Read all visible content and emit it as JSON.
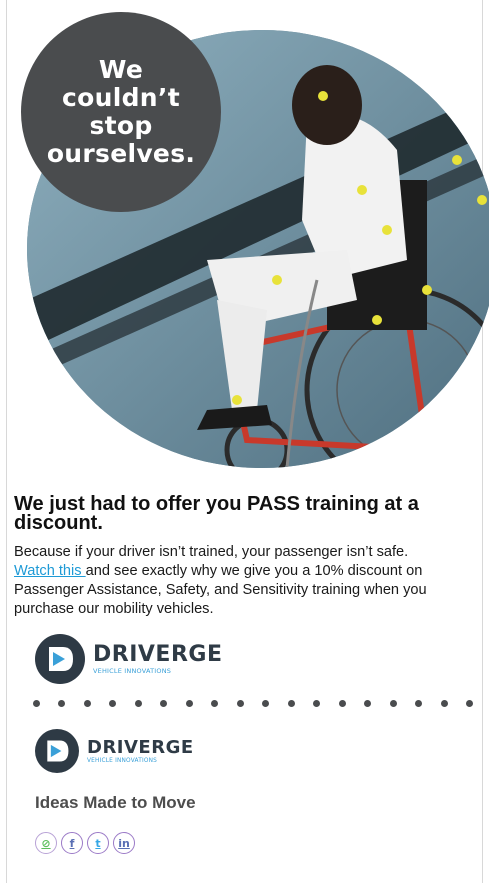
{
  "hero": {
    "bubble_text": "We couldn’t stop ourselves.",
    "image_description_icon": "wheelchair-crash-dummy-image"
  },
  "headline": "We just had to offer you PASS training at a discount.",
  "body": {
    "intro": "Because if your driver isn’t trained, your passenger isn’t safe.",
    "link_text": "Watch this ",
    "rest": "and see exactly why we give you a 10% discount on Passenger Assistance, Safety, and Sensitivity training when you purchase our mobility vehicles."
  },
  "logo": {
    "word": "DRIVERGE",
    "sub": "VEHICLE INNOVATIONS"
  },
  "footer": {
    "tagline": "Ideas Made to Move",
    "social": [
      {
        "icon": "link-icon",
        "glyph": "⊘"
      },
      {
        "icon": "facebook-icon",
        "glyph": "f"
      },
      {
        "icon": "twitter-icon",
        "glyph": "t"
      },
      {
        "icon": "linkedin-icon",
        "glyph": "in"
      }
    ]
  },
  "colors": {
    "bubble": "#4a4c4e",
    "link": "#1e9ad6",
    "brand_dark": "#2f3b46",
    "brand_blue": "#3aa0d8"
  }
}
